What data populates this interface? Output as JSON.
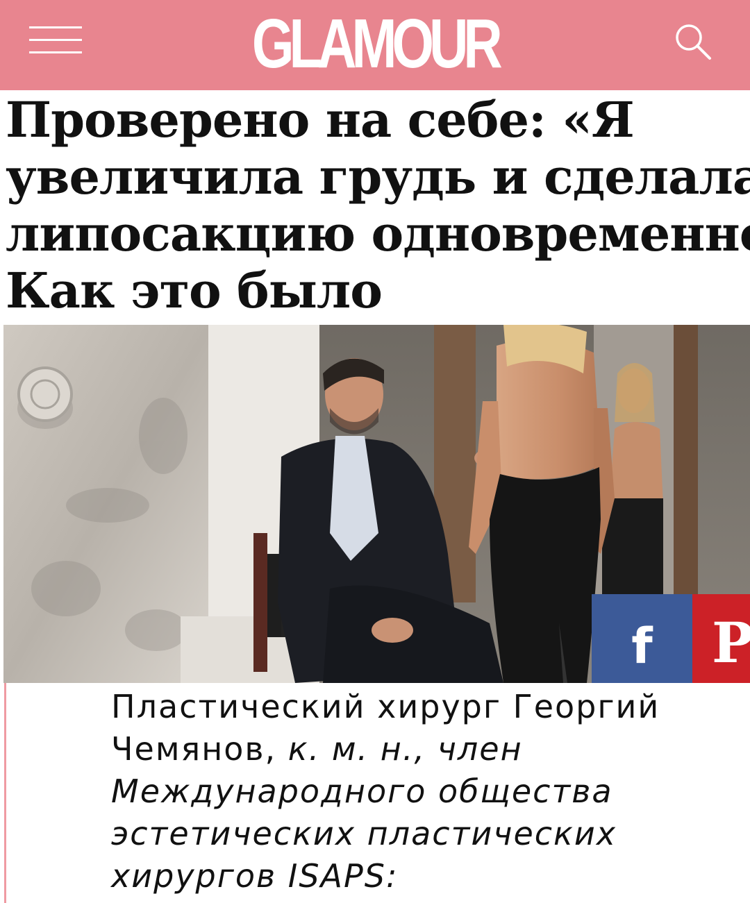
{
  "header": {
    "logo_text": "GLAMOUR",
    "menu_icon": "hamburger-menu-icon",
    "search_icon": "search-icon",
    "background_color": "#e8858f"
  },
  "article": {
    "headline_lines": [
      "Проверено на себе: «Я",
      "увеличила грудь и сделала",
      "липосакцию одновременно",
      "Как это было"
    ],
    "lead": {
      "line1": "Пластический хирург Георгий",
      "line2_name": "Чемянов, ",
      "line2_italic": "к. м. н., член",
      "line3": "Международного общества",
      "line4": "эстетических пластических",
      "line5": "хирургов ISAPS:"
    }
  },
  "share": {
    "facebook_glyph": "f",
    "facebook_color": "#3c5a98",
    "pinterest_glyph": "P",
    "pinterest_color": "#cc2127"
  }
}
